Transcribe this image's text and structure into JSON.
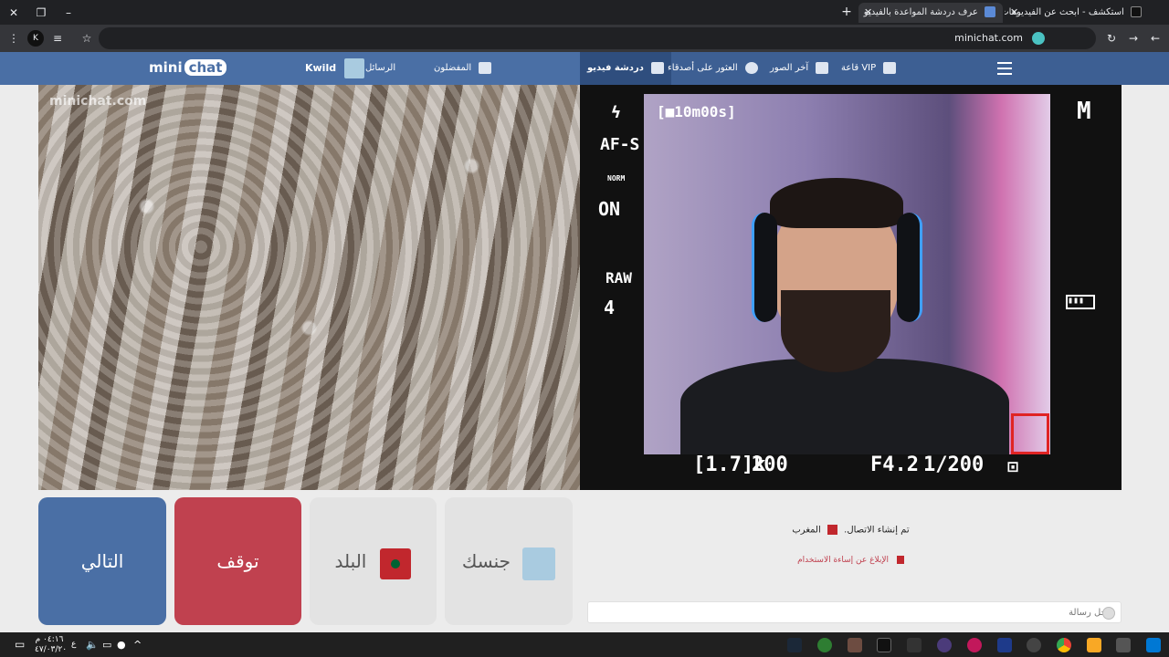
{
  "browser": {
    "tabs": [
      {
        "title": "استكشف - ابحث عن الفيديوهات",
        "active": false
      },
      {
        "title": "عرف دردشة المواعدة بالفيديو",
        "active": true
      }
    ],
    "url": "minichat.com",
    "profile_initial": "K"
  },
  "nav": {
    "menu_label": "",
    "vip": "VIP قاعة",
    "latest_photos": "آخر الصور",
    "find_friends": "العثور على أصدقاء",
    "video_chat": "دردشة فيديو",
    "favorites": "المفضلون",
    "messages": "الرسائل",
    "username": "Kwild",
    "logo_mini": "mini",
    "logo_chat": "chat"
  },
  "remote_video": {
    "watermark": "minichat.com"
  },
  "camera_overlay": {
    "mode": "M",
    "rec_time": "[■10m00s]",
    "af": "AF-S",
    "norm": "NORM",
    "on": "ON",
    "raw": "RAW",
    "four": "4",
    "shutter": "1/200",
    "aperture": "F4.2",
    "iso": "200",
    "shots": "[1.7]k"
  },
  "buttons": {
    "next": "التالي",
    "stop": "توقف",
    "country": "البلد",
    "gender": "جنسك"
  },
  "chat": {
    "connected_msg": "تم إنشاء الاتصال.",
    "country_name": "المغرب",
    "report": "الإبلاغ عن إساءة الاستخدام",
    "input_placeholder": "أدخل رسالة"
  },
  "taskbar": {
    "time": "٠٤:١٦ م",
    "date": "٤٧/٠٣/٢٠",
    "lang": "ع"
  }
}
